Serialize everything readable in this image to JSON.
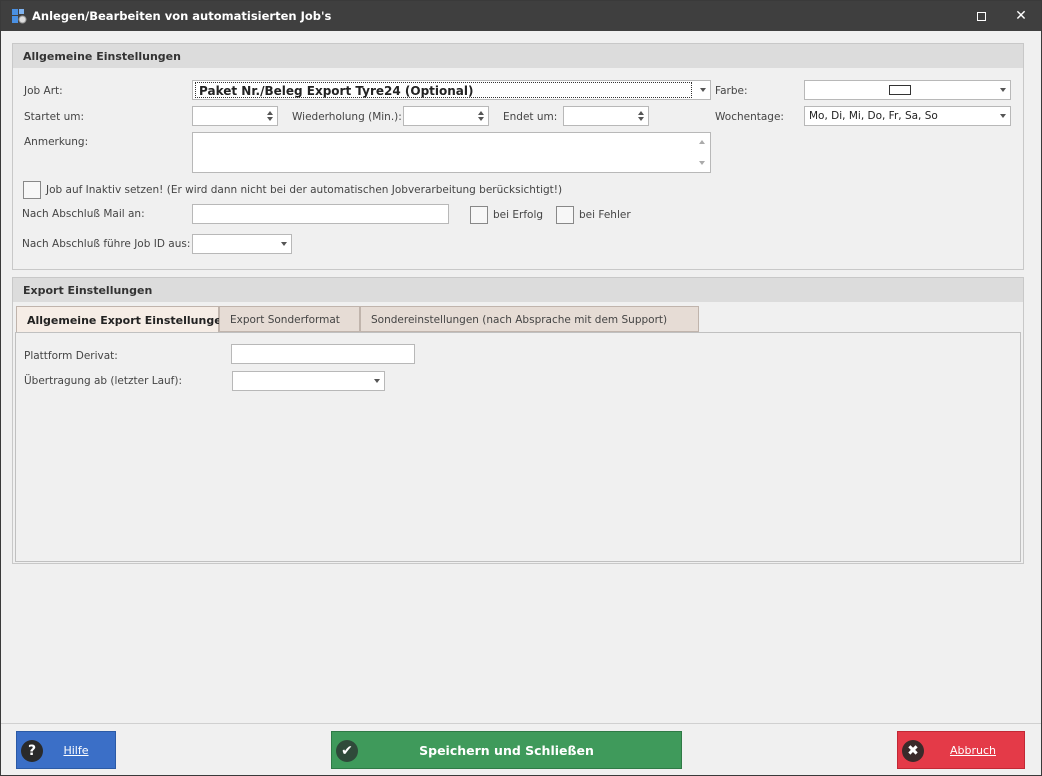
{
  "window": {
    "title": "Anlegen/Bearbeiten von automatisierten Job's"
  },
  "general": {
    "header": "Allgemeine Einstellungen",
    "job_art_label": "Job Art:",
    "job_art_value": "Paket Nr./Beleg Export Tyre24 (Optional)",
    "farbe_label": "Farbe:",
    "startet_label": "Startet um:",
    "startet_value": "",
    "wiederholung_label": "Wiederholung (Min.):",
    "wiederholung_value": "",
    "endet_label": "Endet um:",
    "endet_value": "",
    "wochentage_label": "Wochentage:",
    "wochentage_value": "Mo, Di, Mi, Do, Fr, Sa, So",
    "anmerkung_label": "Anmerkung:",
    "anmerkung_value": "",
    "inaktiv_label": "Job auf Inaktiv setzen! (Er wird dann nicht bei der automatischen Jobverarbeitung berücksichtigt!)",
    "mail_label": "Nach Abschluß Mail an:",
    "mail_value": "",
    "bei_erfolg_label": "bei Erfolg",
    "bei_fehler_label": "bei Fehler",
    "job_id_label": "Nach Abschluß führe Job ID aus:",
    "job_id_value": ""
  },
  "export": {
    "header": "Export Einstellungen",
    "tabs": [
      {
        "label": "Allgemeine Export Einstellungen",
        "active": true
      },
      {
        "label": "Export Sonderformat",
        "active": false
      },
      {
        "label": "Sondereinstellungen (nach Absprache mit dem Support)",
        "active": false
      }
    ],
    "plattform_label": "Plattform Derivat:",
    "plattform_value": "",
    "uebertragung_label": "Übertragung ab (letzter Lauf):",
    "uebertragung_value": ""
  },
  "footer": {
    "hilfe_label": "Hilfe",
    "save_label": "Speichern und Schließen",
    "abbruch_label": "Abbruch"
  },
  "colors": {
    "hilfe": "#3b6fc7",
    "save": "#3f9a5b",
    "abbruch": "#e43a48",
    "titlebar": "#3f3f3f"
  }
}
